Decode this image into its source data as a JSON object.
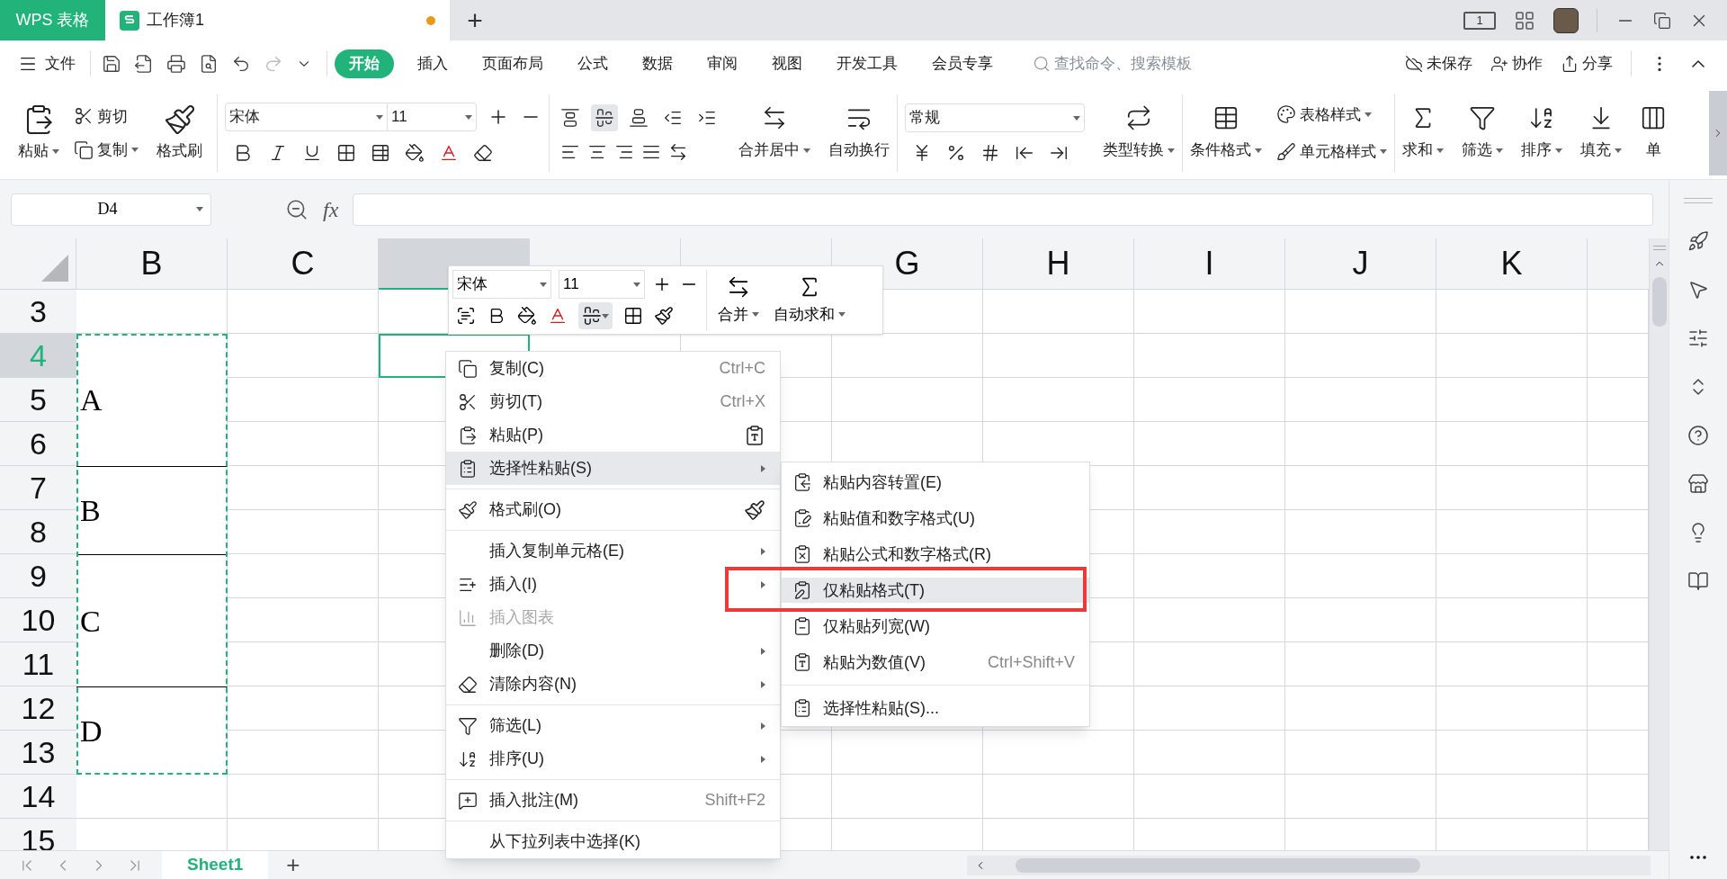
{
  "title_bar": {
    "app_tab": "WPS 表格",
    "doc_tab": {
      "title": "工作簿1",
      "modified": true
    },
    "new_tab": "+",
    "view_badge": "1"
  },
  "menu_bar": {
    "file": "文件",
    "tabs": [
      {
        "label": "开始",
        "selected": true
      },
      {
        "label": "插入",
        "selected": false
      },
      {
        "label": "页面布局",
        "selected": false
      },
      {
        "label": "公式",
        "selected": false
      },
      {
        "label": "数据",
        "selected": false
      },
      {
        "label": "审阅",
        "selected": false
      },
      {
        "label": "视图",
        "selected": false
      },
      {
        "label": "开发工具",
        "selected": false
      },
      {
        "label": "会员专享",
        "selected": false
      }
    ],
    "search": {
      "placeholder": "查找命令、搜索模板"
    },
    "actions": [
      "未保存",
      "协作",
      "分享"
    ]
  },
  "ribbon": {
    "clipboard": {
      "paste": "粘贴",
      "cut": "剪切",
      "copy": "复制",
      "format_painter": "格式刷"
    },
    "font": {
      "name": "宋体",
      "size": "11"
    },
    "align_tools": [
      {
        "selected": false
      },
      {
        "selected": true
      },
      {
        "selected": false
      },
      {
        "selected": false
      },
      {
        "selected": false
      }
    ],
    "alignment": {
      "merge": "合并居中",
      "wrap": "自动换行"
    },
    "number": {
      "format": "常规",
      "convert": "类型转换"
    },
    "styles": {
      "conditional": "条件格式",
      "table_style": "表格样式",
      "cell_style": "单元格样式"
    },
    "editing": [
      "求和",
      "筛选",
      "排序",
      "填充",
      "单"
    ]
  },
  "formula_bar": {
    "name_box": "D4",
    "fx": "fx"
  },
  "sheet": {
    "columns": [
      {
        "label": "B",
        "selected": false
      },
      {
        "label": "C",
        "selected": false
      },
      {
        "selected": true
      },
      {
        "selected": false
      },
      {
        "selected": false
      },
      {
        "label": "G",
        "selected": false
      },
      {
        "label": "H",
        "selected": false
      },
      {
        "label": "I",
        "selected": false
      },
      {
        "label": "J",
        "selected": false
      },
      {
        "label": "K",
        "selected": false
      }
    ],
    "rows": [
      {
        "label": "3",
        "selected": false
      },
      {
        "label": "4",
        "selected": true
      },
      {
        "label": "5",
        "selected": false
      },
      {
        "label": "6",
        "selected": false
      },
      {
        "label": "7",
        "selected": false
      },
      {
        "label": "8",
        "selected": false
      },
      {
        "label": "9",
        "selected": false
      },
      {
        "label": "10",
        "selected": false
      },
      {
        "label": "11",
        "selected": false
      },
      {
        "label": "12",
        "selected": false
      },
      {
        "label": "13",
        "selected": false
      },
      {
        "label": "14",
        "selected": false
      },
      {
        "label": "15",
        "selected": false
      }
    ],
    "column_b_cells": [
      "A",
      "B",
      "C",
      "D"
    ]
  },
  "mini_toolbar": {
    "font": "宋体",
    "size": "11",
    "align_selected": true,
    "merge": "合并",
    "autosum": "自动求和"
  },
  "context_menu": [
    {
      "kind": "item",
      "label": "复制(C)",
      "shortcut": "Ctrl+C",
      "submenu": false,
      "disabled": false,
      "selected": false
    },
    {
      "kind": "item",
      "label": "剪切(T)",
      "shortcut": "Ctrl+X",
      "submenu": false,
      "disabled": false,
      "selected": false
    },
    {
      "kind": "item",
      "label": "粘贴(P)",
      "submenu": false,
      "disabled": false,
      "selected": false
    },
    {
      "kind": "item",
      "label": "选择性粘贴(S)",
      "submenu": true,
      "disabled": false,
      "selected": true
    },
    {
      "kind": "separator"
    },
    {
      "kind": "item",
      "label": "格式刷(O)",
      "submenu": false,
      "disabled": false,
      "selected": false
    },
    {
      "kind": "separator"
    },
    {
      "kind": "item",
      "label": "插入复制单元格(E)",
      "submenu": true,
      "disabled": false,
      "selected": false
    },
    {
      "kind": "item",
      "label": "插入(I)",
      "submenu": true,
      "disabled": false,
      "selected": false
    },
    {
      "kind": "item",
      "label": "插入图表",
      "submenu": false,
      "disabled": true,
      "selected": false
    },
    {
      "kind": "item",
      "label": "删除(D)",
      "submenu": true,
      "disabled": false,
      "selected": false
    },
    {
      "kind": "item",
      "label": "清除内容(N)",
      "submenu": true,
      "disabled": false,
      "selected": false
    },
    {
      "kind": "separator"
    },
    {
      "kind": "item",
      "label": "筛选(L)",
      "submenu": true,
      "disabled": false,
      "selected": false
    },
    {
      "kind": "item",
      "label": "排序(U)",
      "submenu": true,
      "disabled": false,
      "selected": false
    },
    {
      "kind": "separator"
    },
    {
      "kind": "item",
      "label": "插入批注(M)",
      "shortcut": "Shift+F2",
      "submenu": false,
      "disabled": false,
      "selected": false
    },
    {
      "kind": "separator"
    },
    {
      "kind": "item",
      "label": "从下拉列表中选择(K)",
      "submenu": false,
      "disabled": false,
      "selected": false
    }
  ],
  "paste_submenu": [
    {
      "kind": "item",
      "label": "粘贴内容转置(E)",
      "selected": false
    },
    {
      "kind": "item",
      "label": "粘贴值和数字格式(U)",
      "selected": false
    },
    {
      "kind": "item",
      "label": "粘贴公式和数字格式(R)",
      "selected": false
    },
    {
      "kind": "item",
      "label": "仅粘贴格式(T)",
      "selected": true
    },
    {
      "kind": "item",
      "label": "仅粘贴列宽(W)",
      "selected": false
    },
    {
      "kind": "item",
      "label": "粘贴为数值(V)",
      "shortcut": "Ctrl+Shift+V",
      "selected": false
    },
    {
      "kind": "separator"
    },
    {
      "kind": "item",
      "label": "选择性粘贴(S)...",
      "selected": false
    }
  ],
  "sheet_tabs": {
    "tabs": [
      {
        "label": "Sheet1",
        "selected": true
      }
    ],
    "add": "+"
  }
}
